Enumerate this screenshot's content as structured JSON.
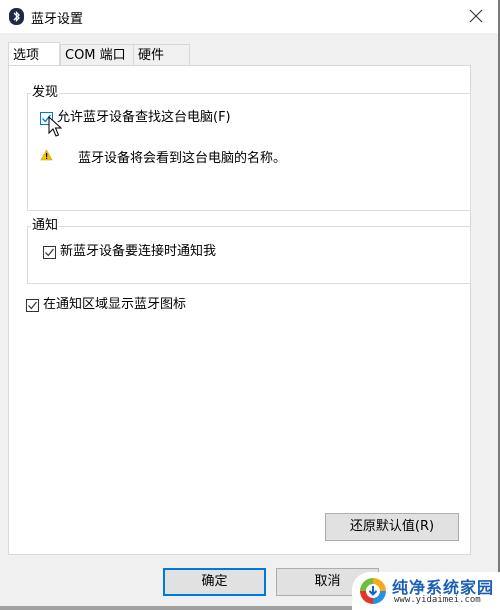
{
  "window": {
    "title": "蓝牙设置",
    "icon": "bluetooth-icon",
    "close_icon": "close-icon"
  },
  "tabs": [
    {
      "label": "选项",
      "active": true
    },
    {
      "label": "COM 端口",
      "active": false
    },
    {
      "label": "硬件",
      "active": false
    }
  ],
  "discovery": {
    "group_label": "发现",
    "allow_discovery_label": "允许蓝牙设备查找这台电脑(F)",
    "allow_discovery_checked": true,
    "warning_icon": "warning-icon",
    "warning_text": "蓝牙设备将会看到这台电脑的名称。"
  },
  "notifications": {
    "group_label": "通知",
    "notify_label": "新蓝牙设备要连接时通知我",
    "notify_checked": true
  },
  "show_tray_icon": {
    "label": "在通知区域显示蓝牙图标",
    "checked": true
  },
  "buttons": {
    "restore_defaults": "还原默认值(R)",
    "ok": "确定",
    "cancel": "取消"
  },
  "watermark": {
    "title": "纯净系统家园",
    "url": "www.yidaimei.com"
  },
  "colors": {
    "accent": "#0078d7",
    "warning": "#f5c400",
    "watermark_blue": "#1b5fb8"
  }
}
